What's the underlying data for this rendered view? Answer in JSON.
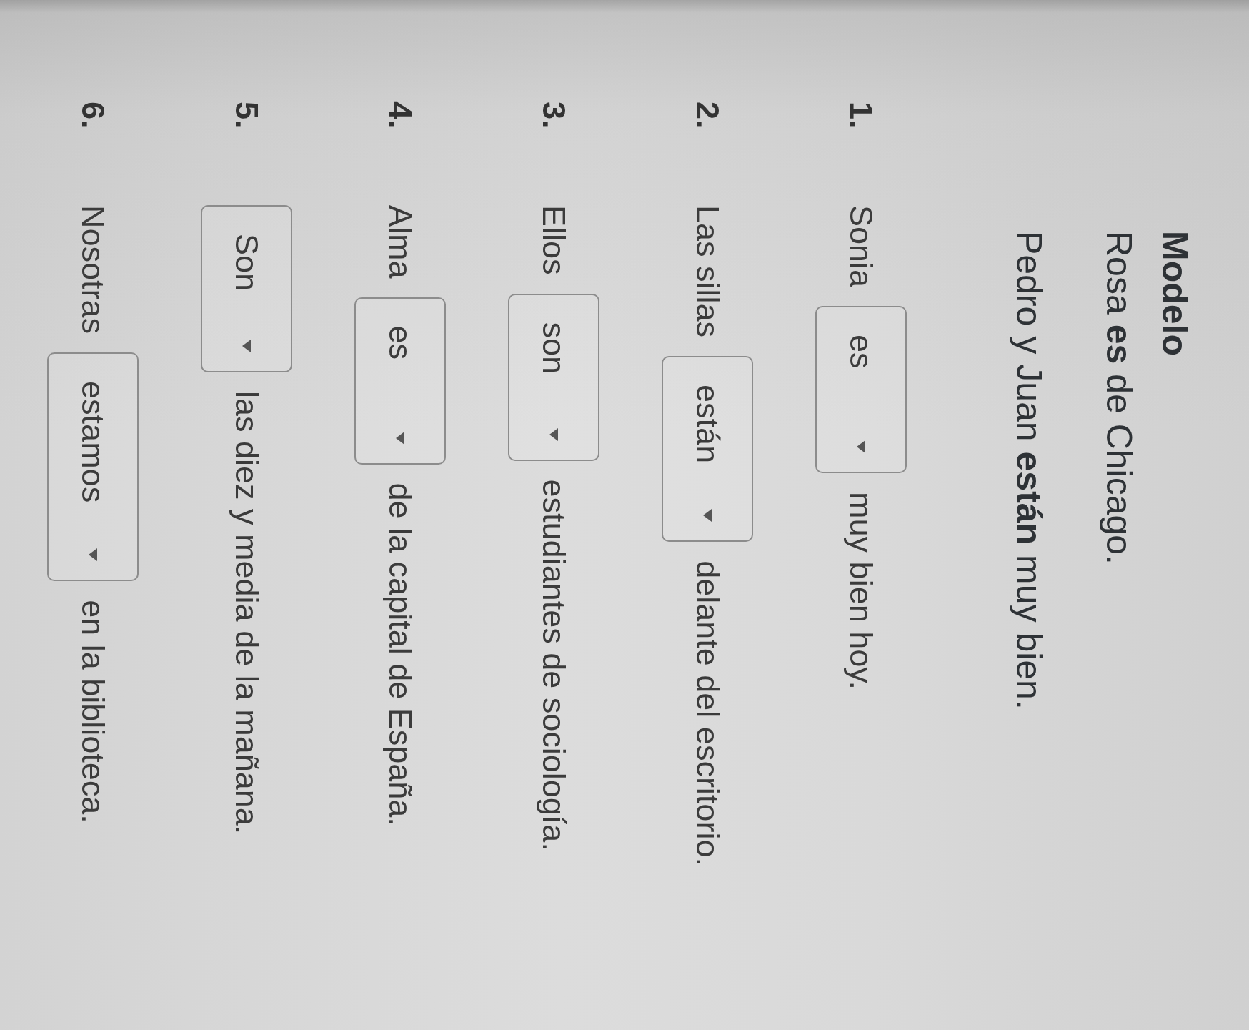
{
  "model": {
    "title": "Modelo",
    "examples": [
      "Rosa **es** de Chicago.",
      "Pedro y Juan **están** muy bien."
    ]
  },
  "items": [
    {
      "number": "1.",
      "subject": "Sonia",
      "answer": "es",
      "rest": "muy bien hoy."
    },
    {
      "number": "2.",
      "subject": "Las sillas",
      "answer": "están",
      "rest": "delante del escritorio."
    },
    {
      "number": "3.",
      "subject": "Ellos",
      "answer": "son",
      "rest": "estudiantes de sociología."
    },
    {
      "number": "4.",
      "subject": "Alma",
      "answer": "es",
      "rest": "de la capital de España."
    },
    {
      "number": "5.",
      "answer": "Son",
      "rest": "las diez y media de la mañana."
    },
    {
      "number": "6.",
      "subject": "Nosotras",
      "answer": "estamos",
      "rest": "en la biblioteca."
    }
  ]
}
